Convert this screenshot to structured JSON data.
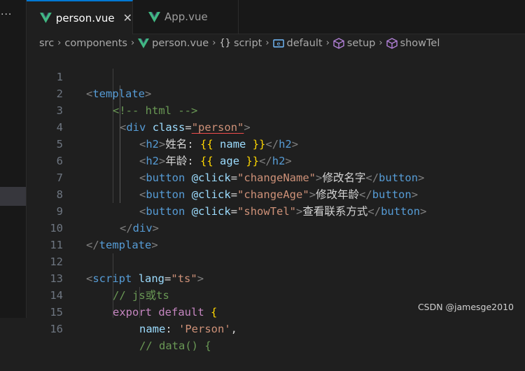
{
  "sidebar": {
    "more_label": "···"
  },
  "tabs": [
    {
      "label": "person.vue",
      "close": "✕",
      "icon": "vue-icon"
    },
    {
      "label": "App.vue",
      "icon": "vue-icon"
    }
  ],
  "breadcrumb": {
    "items": [
      "src",
      "components",
      "person.vue",
      "script",
      "default",
      "setup",
      "showTel"
    ],
    "icons": {
      "script": "{}",
      "default": "namespace-icon",
      "setup": "cube-icon",
      "showTel": "cube-icon"
    }
  },
  "colors": {
    "vue_green": "#41b883",
    "accent": "#0078d4",
    "tag_name": "#569cd6",
    "attr": "#9cdcfe",
    "string": "#ce9178",
    "comment": "#6a9955",
    "keyword": "#c586c0",
    "brace": "#ffd700"
  },
  "code": {
    "line_numbers": [
      "1",
      "2",
      "3",
      "4",
      "5",
      "6",
      "7",
      "8",
      "9",
      "10",
      "11",
      "12",
      "13",
      "14",
      "15",
      "16"
    ],
    "l1": {
      "tag": "template"
    },
    "l2": {
      "comment": "<!-- html -->"
    },
    "l3": {
      "tag": "div",
      "attr": "class",
      "value": "\"person\""
    },
    "l4": {
      "tag": "h2",
      "text": "姓名: ",
      "open": "{{",
      "var": "name",
      "close": "}}"
    },
    "l5": {
      "tag": "h2",
      "text": "年龄: ",
      "open": "{{",
      "var": "age",
      "close": "}}"
    },
    "l6": {
      "tag": "button",
      "attr": "@click",
      "value": "\"changeName\"",
      "text": "修改名字"
    },
    "l7": {
      "tag": "button",
      "attr": "@click",
      "value": "\"changeAge\"",
      "text": "修改年龄"
    },
    "l8": {
      "tag": "button",
      "attr": "@click",
      "value": "\"showTel\"",
      "text": "查看联系方式"
    },
    "l9": {
      "tag": "div"
    },
    "l10": {
      "tag": "template"
    },
    "l12": {
      "tag": "script",
      "attr": "lang",
      "value": "\"ts\""
    },
    "l13": {
      "comment": "// js或ts"
    },
    "l14": {
      "kw1": "export",
      "kw2": "default",
      "brace": "{"
    },
    "l15": {
      "prop": "name",
      "value": "'Person'",
      "comma": ","
    },
    "l16": {
      "comment": "// data() {"
    }
  },
  "watermark": "CSDN @jamesge2010"
}
